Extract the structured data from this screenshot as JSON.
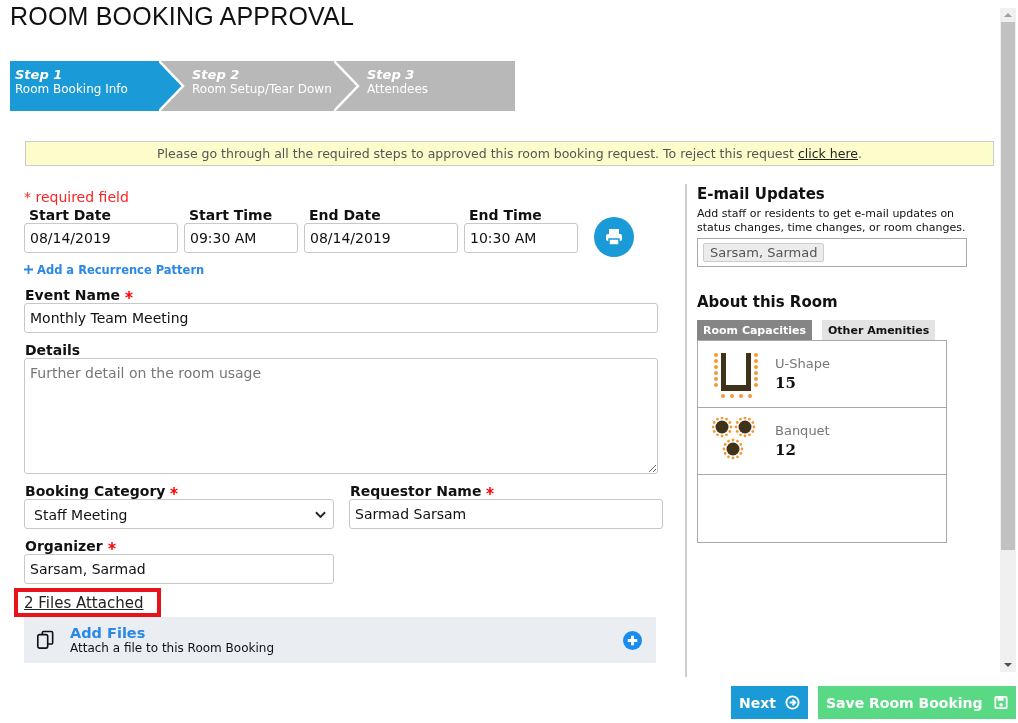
{
  "title": "ROOM BOOKING APPROVAL",
  "steps": [
    {
      "step": "Step 1",
      "label": "Room Booking Info",
      "selected": true
    },
    {
      "step": "Step 2",
      "label": "Room Setup/Tear Down",
      "selected": false
    },
    {
      "step": "Step 3",
      "label": "Attendees",
      "selected": false
    }
  ],
  "notice": {
    "text": "Please go through all the required steps to approved this room booking request. To reject this request",
    "link": "click here",
    "end": "."
  },
  "required_note": "* required field",
  "schedule": [
    {
      "label": "Start Date",
      "value": "08/14/2019"
    },
    {
      "label": "Start Time",
      "value": "09:30 AM"
    },
    {
      "label": "End Date",
      "value": "08/14/2019"
    },
    {
      "label": "End Time",
      "value": "10:30 AM"
    }
  ],
  "recurrence_link": "Add a Recurrence Pattern",
  "event_name": {
    "label": "Event Name",
    "required": true,
    "value": "Monthly Team Meeting"
  },
  "details": {
    "label": "Details",
    "placeholder": "Further detail on the room usage"
  },
  "booking_category": {
    "label": "Booking Category",
    "required": true,
    "value": "Staff Meeting"
  },
  "requestor_name": {
    "label": "Requestor Name",
    "required": true,
    "value": "Sarmad Sarsam"
  },
  "organizer": {
    "label": "Organizer",
    "required": true,
    "value": "Sarsam, Sarmad"
  },
  "files_link": "2 Files Attached",
  "add_files": {
    "title": "Add Files",
    "subtitle": "Attach a file to this Room Booking"
  },
  "email_updates": {
    "title": "E-mail Updates",
    "description": "Add staff or residents to get e-mail updates on status changes, time changes, or room changes.",
    "recipients": [
      "Sarsam, Sarmad"
    ]
  },
  "about_room": {
    "title": "About this Room",
    "tabs": [
      {
        "label": "Room Capacities",
        "selected": true
      },
      {
        "label": "Other Amenities",
        "selected": false
      }
    ],
    "capacities": [
      {
        "kind": "u-shape",
        "name": "U-Shape",
        "count": "15"
      },
      {
        "kind": "banquet",
        "name": "Banquet",
        "count": "12"
      }
    ]
  },
  "buttons": [
    {
      "kind": "next",
      "label": "Next"
    },
    {
      "kind": "save",
      "label": "Save Room Booking"
    }
  ]
}
